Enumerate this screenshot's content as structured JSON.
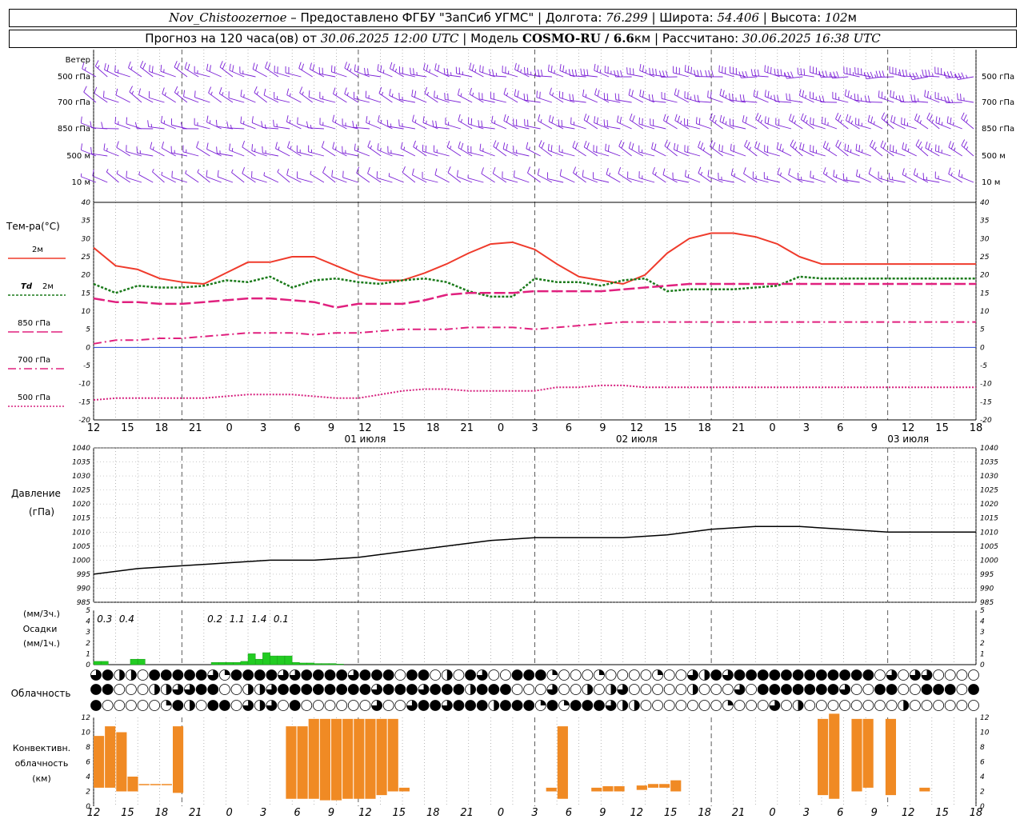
{
  "header": {
    "line1": {
      "station": "Nov_Chistoozernoe",
      "provider": " – Предоставлено ФГБУ \"ЗапСиб УГМС\" | Долгота: ",
      "lon": "76.299",
      "lat_label": " | Широта: ",
      "lat": "54.406",
      "alt_label": " | Высота: ",
      "alt": "102",
      "alt_unit": "м"
    },
    "line2": {
      "prefix": "Прогноз на 120 часа(ов) от ",
      "start": "30.06.2025 12:00 UTC",
      "model_label": " | Модель ",
      "model": "COSMO-RU / 6.6",
      "model_unit": "км",
      "calc_label": " | Рассчитано: ",
      "calc": "30.06.2025 16:38 UTC"
    }
  },
  "time_axis": {
    "hour_labels": [
      "12",
      "15",
      "18",
      "21",
      "0",
      "3",
      "6",
      "9",
      "12",
      "15",
      "18",
      "21",
      "0",
      "3",
      "6",
      "9",
      "12",
      "15",
      "18",
      "21",
      "0",
      "3",
      "6",
      "9",
      "12",
      "15",
      "18"
    ],
    "day_labels": [
      {
        "text": "01 июля",
        "index": 8
      },
      {
        "text": "02 июля",
        "index": 16
      },
      {
        "text": "03 июля",
        "index": 24
      }
    ]
  },
  "labels": {
    "wind_title": "Ветер",
    "wind_levels": [
      "500 гПа",
      "700 гПа",
      "850 гПа",
      "500 м",
      "10 м"
    ],
    "temp_title": "Тем-ра(°C)",
    "legend_2m": "2м",
    "legend_td": "Td",
    "legend_td_suffix": "2м",
    "legend_850": "850 гПа",
    "legend_700": "700 гПа",
    "legend_500": "500 гПа",
    "pressure_title": "Давление",
    "pressure_unit": "(гПа)",
    "precip_unit1": "(мм/3ч.)",
    "precip_title": "Осадки",
    "precip_unit2": "(мм/1ч.)",
    "cloud_title": "Облачность",
    "conv_title1": "Конвективн.",
    "conv_title2": "облачность",
    "conv_unit": "(км)"
  },
  "colors": {
    "wind": "#7a1fd6",
    "t2m": "#ef3b2c",
    "td2m": "#1a7a1a",
    "t850": "#e0207e",
    "t700": "#e0207e",
    "t500": "#d6207e",
    "zero_line": "#1f3fd6",
    "precip": "#22cc22",
    "convective": "#f08a24"
  },
  "chart_data": [
    {
      "type": "line",
      "name": "temperature",
      "x_unit": "hours from 30.06.2025 12:00 UTC",
      "ylim": [
        -20,
        40
      ],
      "yticks": [
        -20,
        -15,
        -10,
        -5,
        0,
        5,
        10,
        15,
        20,
        25,
        30,
        35,
        40
      ],
      "x": [
        0,
        3,
        6,
        9,
        12,
        15,
        18,
        21,
        24,
        27,
        30,
        33,
        36,
        39,
        42,
        45,
        48,
        51,
        54,
        57,
        60,
        63,
        66,
        69,
        72,
        75,
        78,
        81,
        84,
        87,
        90,
        93,
        96,
        99,
        102,
        105,
        108,
        111,
        114,
        117,
        120
      ],
      "series": [
        {
          "name": "2м",
          "values": [
            27.5,
            22.5,
            21.5,
            19,
            18,
            17.5,
            20.5,
            23.5,
            23.5,
            25,
            25,
            22.5,
            20,
            18.5,
            18.5,
            20.5,
            23,
            26,
            28.5,
            29,
            27,
            23,
            19.5,
            18.5,
            17.5,
            20,
            26,
            30,
            31.5,
            31.5,
            30.5,
            28.5,
            25,
            23,
            23,
            23,
            23,
            23,
            23,
            23,
            23
          ]
        },
        {
          "name": "Td 2м",
          "values": [
            17.5,
            15,
            17,
            16.5,
            16.5,
            17,
            18.5,
            18,
            19.5,
            16.5,
            18.5,
            19,
            18,
            17.5,
            18.5,
            19,
            18,
            15.5,
            14,
            14,
            19,
            18,
            18,
            17,
            18.5,
            19,
            15.5,
            16,
            16,
            16,
            16.5,
            17,
            19.5,
            19,
            19,
            19,
            19,
            19,
            19,
            19,
            19
          ]
        },
        {
          "name": "850 гПа",
          "values": [
            13.5,
            12.5,
            12.5,
            12,
            12,
            12.5,
            13,
            13.5,
            13.5,
            13,
            12.5,
            11,
            12,
            12,
            12,
            13,
            14.5,
            15,
            15,
            15,
            15.5,
            15.5,
            15.5,
            15.5,
            16,
            16.5,
            17,
            17.5,
            17.5,
            17.5,
            17.5,
            17.5,
            17.5,
            17.5,
            17.5,
            17.5,
            17.5,
            17.5,
            17.5,
            17.5,
            17.5
          ]
        },
        {
          "name": "700 гПа",
          "values": [
            1,
            2,
            2,
            2.5,
            2.5,
            3,
            3.5,
            4,
            4,
            4,
            3.5,
            4,
            4,
            4.5,
            5,
            5,
            5,
            5.5,
            5.5,
            5.5,
            5,
            5.5,
            6,
            6.5,
            7,
            7,
            7,
            7,
            7,
            7,
            7,
            7,
            7,
            7,
            7,
            7,
            7,
            7,
            7,
            7,
            7
          ]
        },
        {
          "name": "500 гПа",
          "values": [
            -14.5,
            -14,
            -14,
            -14,
            -14,
            -14,
            -13.5,
            -13,
            -13,
            -13,
            -13.5,
            -14,
            -14,
            -13,
            -12,
            -11.5,
            -11.5,
            -12,
            -12,
            -12,
            -12,
            -11,
            -11,
            -10.5,
            -10.5,
            -11,
            -11,
            -11,
            -11,
            -11,
            -11,
            -11,
            -11,
            -11,
            -11,
            -11,
            -11,
            -11,
            -11,
            -11,
            -11
          ]
        }
      ]
    },
    {
      "type": "line",
      "name": "pressure",
      "ylim": [
        985,
        1040
      ],
      "yticks": [
        985,
        990,
        995,
        1000,
        1005,
        1010,
        1015,
        1020,
        1025,
        1030,
        1035,
        1040
      ],
      "x": [
        0,
        6,
        12,
        18,
        24,
        30,
        36,
        42,
        48,
        54,
        60,
        66,
        72,
        78,
        84,
        90,
        96,
        102,
        108,
        114,
        120
      ],
      "series": [
        {
          "name": "Давление",
          "values": [
            995,
            997,
            998,
            999,
            1000,
            1000,
            1001,
            1003,
            1005,
            1007,
            1008,
            1008,
            1008,
            1009,
            1011,
            1012,
            1012,
            1011,
            1010,
            1010,
            1010
          ]
        }
      ]
    },
    {
      "type": "bar",
      "name": "precipitation",
      "ylim": [
        0,
        5
      ],
      "yticks": [
        0,
        1,
        2,
        3,
        4,
        5
      ],
      "hourly_x": [
        0,
        1,
        5,
        6,
        16,
        17,
        18,
        19,
        20,
        21,
        22,
        23,
        24,
        25,
        26,
        27,
        28,
        29,
        30,
        31,
        32,
        33
      ],
      "hourly_values": [
        0.3,
        0.3,
        0.5,
        0.5,
        0.2,
        0.2,
        0.2,
        0.2,
        0.3,
        1.0,
        0.5,
        1.1,
        0.8,
        0.8,
        0.8,
        0.2,
        0.15,
        0.15,
        0.1,
        0.1,
        0.1,
        0.05
      ],
      "three_hour_labels": [
        {
          "x": 1.5,
          "text": "0.3"
        },
        {
          "x": 4.5,
          "text": "0.4"
        },
        {
          "x": 16.5,
          "text": "0.2"
        },
        {
          "x": 19.5,
          "text": "1.1"
        },
        {
          "x": 22.5,
          "text": "1.4"
        },
        {
          "x": 25.5,
          "text": "0.1"
        }
      ]
    },
    {
      "type": "table",
      "name": "cloudiness",
      "row1": "3422044444314444334444344404402043004441000100001003243444444444444030330000",
      "row2": "4400022334400223444444443444344424440003002023000002000304444444300440044404",
      "row3": "4000001420440323040000003003443444244414144432200000001000302000000002000000"
    },
    {
      "type": "bar",
      "name": "convective_cloud",
      "ylim": [
        0,
        12
      ],
      "yticks": [
        0,
        2,
        4,
        6,
        8,
        10,
        12
      ],
      "bars": [
        {
          "x": 0,
          "base": 2.5,
          "top": 9.5
        },
        {
          "x": 1,
          "base": 2.5,
          "top": 10.8
        },
        {
          "x": 2,
          "base": 2.0,
          "top": 10.0
        },
        {
          "x": 3,
          "base": 2.0,
          "top": 4.0
        },
        {
          "x": 4,
          "base": 3.0,
          "top": 3.0
        },
        {
          "x": 5,
          "base": 3.0,
          "top": 3.0
        },
        {
          "x": 6,
          "base": 3.0,
          "top": 3.0
        },
        {
          "x": 7,
          "base": 1.8,
          "top": 10.8
        },
        {
          "x": 17,
          "base": 1.0,
          "top": 10.8
        },
        {
          "x": 18,
          "base": 1.0,
          "top": 10.8
        },
        {
          "x": 19,
          "base": 1.0,
          "top": 11.8
        },
        {
          "x": 20,
          "base": 0.8,
          "top": 11.8
        },
        {
          "x": 21,
          "base": 0.8,
          "top": 11.8
        },
        {
          "x": 22,
          "base": 1.0,
          "top": 11.8
        },
        {
          "x": 23,
          "base": 1.0,
          "top": 11.8
        },
        {
          "x": 24,
          "base": 1.0,
          "top": 11.8
        },
        {
          "x": 25,
          "base": 1.5,
          "top": 11.8
        },
        {
          "x": 26,
          "base": 2.0,
          "top": 11.8
        },
        {
          "x": 27,
          "base": 2.0,
          "top": 2.5
        },
        {
          "x": 40,
          "base": 2.0,
          "top": 2.5
        },
        {
          "x": 41,
          "base": 1.0,
          "top": 10.8
        },
        {
          "x": 44,
          "base": 2.0,
          "top": 2.5
        },
        {
          "x": 45,
          "base": 2.0,
          "top": 2.7
        },
        {
          "x": 46,
          "base": 2.0,
          "top": 2.7
        },
        {
          "x": 48,
          "base": 2.2,
          "top": 2.8
        },
        {
          "x": 49,
          "base": 2.5,
          "top": 3.0
        },
        {
          "x": 50,
          "base": 2.5,
          "top": 3.0
        },
        {
          "x": 51,
          "base": 2.0,
          "top": 3.5
        },
        {
          "x": 64,
          "base": 1.5,
          "top": 11.8
        },
        {
          "x": 65,
          "base": 1.0,
          "top": 12.5
        },
        {
          "x": 67,
          "base": 2.0,
          "top": 11.8
        },
        {
          "x": 68,
          "base": 2.5,
          "top": 11.8
        },
        {
          "x": 70,
          "base": 1.5,
          "top": 11.8
        },
        {
          "x": 73,
          "base": 2.0,
          "top": 2.5
        }
      ]
    },
    {
      "type": "barbs",
      "name": "wind",
      "rows": [
        {
          "level": "500 гПа",
          "dir_start": 300,
          "dir_end": 270,
          "spd_start": 15,
          "spd_end": 35
        },
        {
          "level": "700 гПа",
          "dir_start": 300,
          "dir_end": 280,
          "spd_start": 10,
          "spd_end": 25
        },
        {
          "level": "850 гПа",
          "dir_start": 280,
          "dir_end": 300,
          "spd_start": 10,
          "spd_end": 25
        },
        {
          "level": "500 м",
          "dir_start": 290,
          "dir_end": 300,
          "spd_start": 10,
          "spd_end": 25
        },
        {
          "level": "10 м",
          "dir_start": 300,
          "dir_end": 290,
          "spd_start": 5,
          "spd_end": 15
        }
      ]
    }
  ]
}
